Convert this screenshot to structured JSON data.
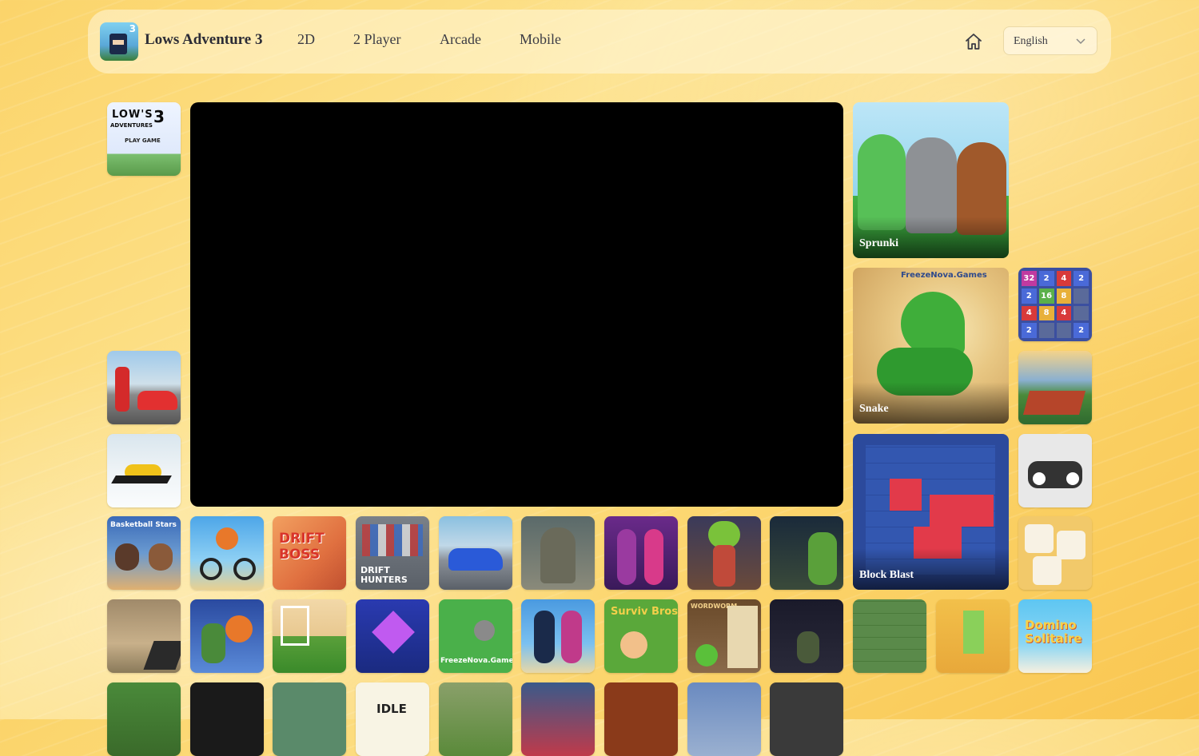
{
  "header": {
    "site_title": "Lows Adventure 3",
    "logo_badge": "3",
    "nav": [
      {
        "label": "2D"
      },
      {
        "label": "2 Player"
      },
      {
        "label": "Arcade"
      },
      {
        "label": "Mobile"
      }
    ],
    "language": "English"
  },
  "featured": [
    {
      "label": "Sprunki"
    },
    {
      "label": "Snake"
    },
    {
      "label": "Block Blast"
    }
  ],
  "thumb_text": {
    "lows_title": "LOW'S",
    "lows_sub": "ADVENTURES",
    "lows_num": "3",
    "lows_play": "PLAY GAME",
    "basketball": "Basketball Stars",
    "drift_boss": "DRIFT BOSS",
    "drift_hunters": "DRIFT HUNTERS",
    "freezenova": "FreezeNova.Games",
    "surviv": "Surviv Bros",
    "wordworm": "WORDWORM",
    "domino": "Domino Solitaire",
    "idle": "IDLE",
    "g2048_numbers": [
      "32",
      "2",
      "4",
      "2",
      "2",
      "16",
      "8",
      "",
      "4",
      "8",
      "4",
      "",
      "2",
      "",
      "",
      "2"
    ]
  },
  "colors": {
    "accent": "#fbd46a",
    "text": "#2c2c36"
  }
}
